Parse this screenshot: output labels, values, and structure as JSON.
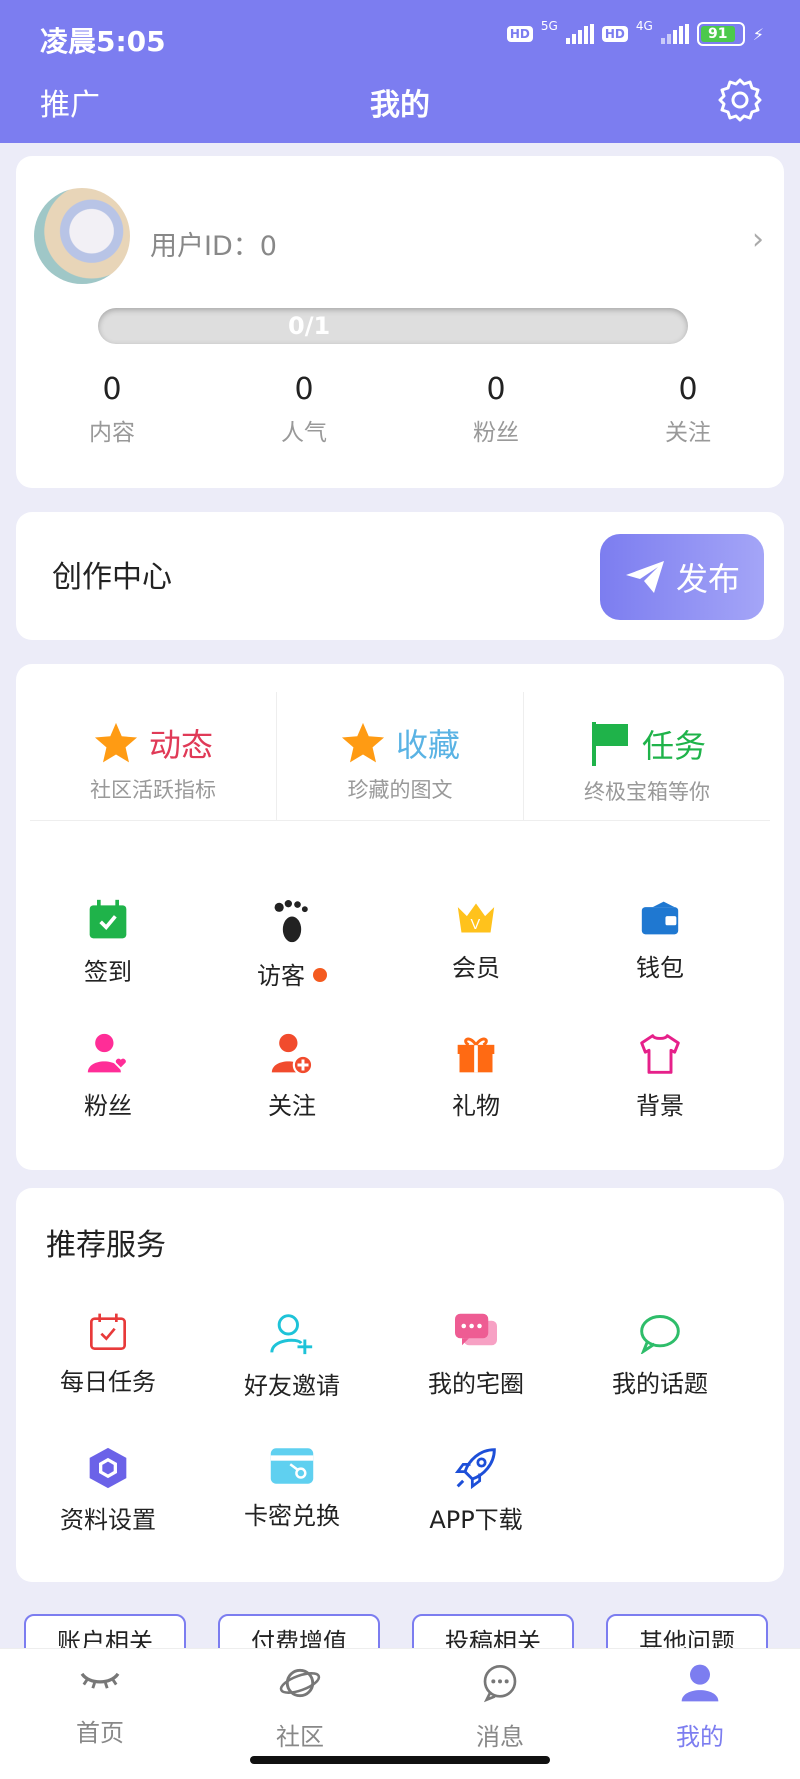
{
  "status": {
    "time": "凌晨5:05",
    "hd1": "HD",
    "net1": "5G",
    "hd2": "HD",
    "net2": "4G",
    "battery": "91"
  },
  "nav": {
    "left": "推广",
    "title": "我的"
  },
  "profile": {
    "uid_label": "用户ID：0",
    "level_text": "0/1",
    "level_progress": 0,
    "stats": [
      {
        "value": "0",
        "label": "内容"
      },
      {
        "value": "0",
        "label": "人气"
      },
      {
        "value": "0",
        "label": "粉丝"
      },
      {
        "value": "0",
        "label": "关注"
      }
    ]
  },
  "create": {
    "title": "创作中心",
    "publish": "发布"
  },
  "features": {
    "top": [
      {
        "title": "动态",
        "sub": "社区活跃指标",
        "color": "#e03a57",
        "icon": "star-icon"
      },
      {
        "title": "收藏",
        "sub": "珍藏的图文",
        "color": "#5ab3e4",
        "icon": "star-icon"
      },
      {
        "title": "任务",
        "sub": "终极宝箱等你",
        "color": "#1fb34a",
        "icon": "flag-icon"
      }
    ],
    "row1": [
      {
        "label": "签到",
        "icon": "calendar-check-icon"
      },
      {
        "label": "访客",
        "icon": "footprint-icon"
      },
      {
        "label": "会员",
        "icon": "crown-icon"
      },
      {
        "label": "钱包",
        "icon": "wallet-icon"
      }
    ],
    "row2": [
      {
        "label": "粉丝",
        "icon": "user-heart-icon"
      },
      {
        "label": "关注",
        "icon": "user-plus-icon"
      },
      {
        "label": "礼物",
        "icon": "gift-icon"
      },
      {
        "label": "背景",
        "icon": "shirt-icon"
      }
    ]
  },
  "recommend": {
    "title": "推荐服务",
    "row1": [
      {
        "label": "每日任务",
        "icon": "calendar-task-icon"
      },
      {
        "label": "好友邀请",
        "icon": "invite-user-icon"
      },
      {
        "label": "我的宅圈",
        "icon": "chat-bubbles-icon"
      },
      {
        "label": "我的话题",
        "icon": "speech-bubble-icon"
      }
    ],
    "row2": [
      {
        "label": "资料设置",
        "icon": "hexagon-settings-icon"
      },
      {
        "label": "卡密兑换",
        "icon": "card-key-icon"
      },
      {
        "label": "APP下载",
        "icon": "rocket-icon"
      }
    ]
  },
  "help_tags": [
    "账户相关",
    "付费增值",
    "投稿相关",
    "其他问题"
  ],
  "tabs": [
    {
      "label": "首页",
      "icon": "eye-closed-icon",
      "active": false
    },
    {
      "label": "社区",
      "icon": "planet-icon",
      "active": false
    },
    {
      "label": "消息",
      "icon": "message-icon",
      "active": false
    },
    {
      "label": "我的",
      "icon": "user-icon",
      "active": true
    }
  ],
  "colors": {
    "accent": "#7c7df0",
    "page_bg": "#ececf8"
  }
}
